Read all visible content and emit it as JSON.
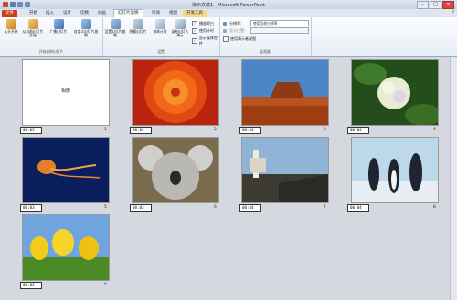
{
  "window": {
    "title": "演示文稿1 - Microsoft PowerPoint",
    "buttons": {
      "minimize": "–",
      "maximize": "□",
      "close": "✕"
    }
  },
  "tabs": [
    {
      "label": "文件"
    },
    {
      "label": "开始"
    },
    {
      "label": "插入"
    },
    {
      "label": "设计"
    },
    {
      "label": "切换"
    },
    {
      "label": "动画"
    },
    {
      "label": "幻灯片放映"
    },
    {
      "label": "审阅"
    },
    {
      "label": "视图"
    },
    {
      "label": "开发工具"
    }
  ],
  "context_header": "图片工具",
  "ribbon": {
    "groups": {
      "start_show": "开始放映幻灯片",
      "setup": "设置",
      "monitors": "监视器"
    },
    "buttons": {
      "from_beginning": "从头开始",
      "from_current": "从当前幻灯片开始",
      "broadcast": "广播幻灯片",
      "custom": "自定义幻灯片放映",
      "setup_show": "设置幻灯片放映",
      "hide_slide": "隐藏幻灯片",
      "rehearse": "排练计时",
      "record": "录制幻灯片演示"
    },
    "checks": {
      "play_narrations": "播放旁白",
      "use_timings": "使用计时",
      "show_media": "显示媒体控件",
      "presenter_view": "使用演示者视图"
    },
    "combos": {
      "resolution_label": "分辨率:",
      "resolution_value": "使用当前分辨率",
      "show_on_label": "显示位置:",
      "show_on_value": ""
    }
  },
  "slides": [
    {
      "number": "1",
      "time": "00:05",
      "caption": "相册"
    },
    {
      "number": "2",
      "time": "00:03"
    },
    {
      "number": "3",
      "time": "00:04"
    },
    {
      "number": "4",
      "time": "00:04"
    },
    {
      "number": "5",
      "time": "00:03"
    },
    {
      "number": "6",
      "time": "00:03"
    },
    {
      "number": "7",
      "time": "00:04"
    },
    {
      "number": "8",
      "time": "00:04"
    },
    {
      "number": "9",
      "time": "00:03"
    }
  ],
  "colors": {
    "file_tab": "#c53d1c",
    "ribbon_bg": "#fbfcfe",
    "canvas_bg": "#d5d8de"
  }
}
